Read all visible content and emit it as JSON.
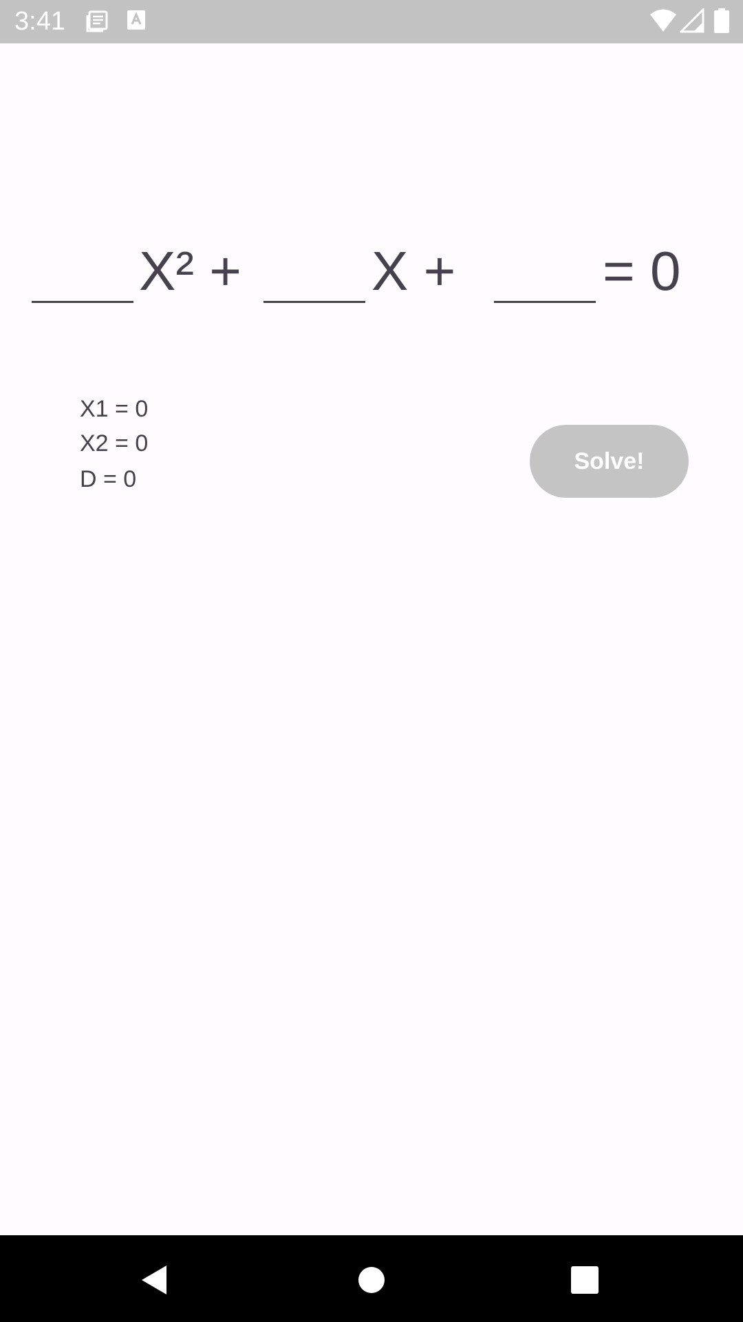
{
  "status_bar": {
    "time": "3:41",
    "left_icons": [
      "news-notification-icon",
      "text-a-notification-icon"
    ],
    "right_icons": [
      "wifi-icon",
      "cell-signal-icon",
      "battery-icon"
    ]
  },
  "equation": {
    "a_value": "",
    "b_value": "",
    "c_value": "",
    "term_a": "X² +",
    "term_b": "X +",
    "equals": "= 0"
  },
  "results": {
    "x1": "X1 = 0",
    "x2": "X2 = 0",
    "d": "D = 0"
  },
  "solve_button": {
    "label": "Solve!",
    "state": "disabled"
  },
  "nav_bar": {
    "buttons": [
      "back-icon",
      "home-icon",
      "recents-icon"
    ]
  },
  "colors": {
    "background": "#fffbfe",
    "text": "#46424d",
    "status_bar": "#c2c2c2",
    "button_disabled": "#c4c4c4",
    "nav_bar": "#000000"
  }
}
